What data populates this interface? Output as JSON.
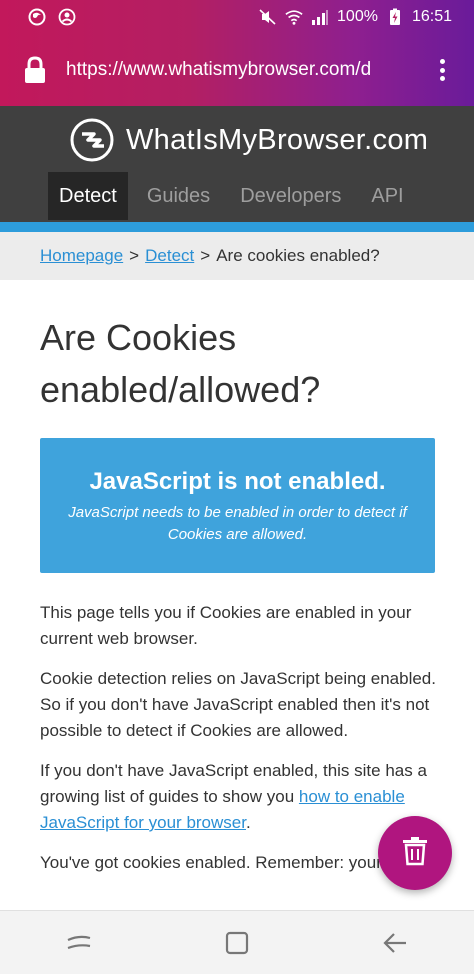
{
  "status_bar": {
    "battery": "100%",
    "time": "16:51"
  },
  "browser": {
    "url": "https://www.whatismybrowser.com/d"
  },
  "site": {
    "name": "WhatIsMyBrowser.com",
    "nav": [
      {
        "label": "Detect"
      },
      {
        "label": "Guides"
      },
      {
        "label": "Developers"
      },
      {
        "label": "API"
      }
    ]
  },
  "breadcrumb": {
    "home": "Homepage",
    "sep1": ">",
    "detect": "Detect",
    "sep2": ">",
    "current": "Are cookies enabled?"
  },
  "page": {
    "title": "Are Cookies enabled/allowed?",
    "alert_title": "JavaScript is not enabled.",
    "alert_body": "JavaScript needs to be enabled in order to detect if Cookies are allowed.",
    "p1": "This page tells you if Cookies are enabled in your current web browser.",
    "p2": "Cookie detection relies on JavaScript being enabled. So if you don't have JavaScript enabled then it's not possible to detect if Cookies are allowed.",
    "p3_before": "If you don't have JavaScript enabled, this site has a growing list of guides to show you ",
    "p3_link": "how to enable JavaScript for your browser",
    "p3_after": ".",
    "p4": "You've got cookies enabled. Remember: your"
  },
  "colors": {
    "accent_blue": "#2d9cdb",
    "fab": "#b0157f",
    "header": "#404040"
  }
}
